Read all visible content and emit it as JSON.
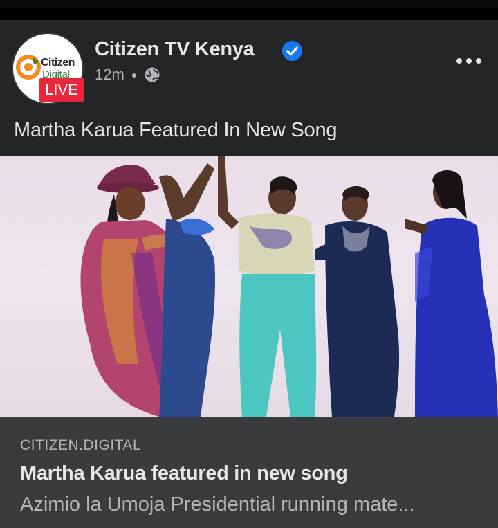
{
  "post": {
    "page_name": "Citizen TV Kenya",
    "verified": true,
    "time_ago": "12m",
    "privacy_icon": "globe-icon",
    "caption": "Martha Karua Featured In New Song"
  },
  "avatar": {
    "brand_line1": "Citizen",
    "brand_line2": "Digital",
    "live_badge": "LIVE"
  },
  "link_preview": {
    "domain": "CITIZEN.DIGITAL",
    "title": "Martha Karua featured in new song",
    "description": "Azimio la Umoja Presidential running mate..."
  },
  "colors": {
    "card_bg": "#242526",
    "link_bg": "#3a3b3c",
    "verified_blue": "#1877f2",
    "live_red": "#e8273b"
  }
}
